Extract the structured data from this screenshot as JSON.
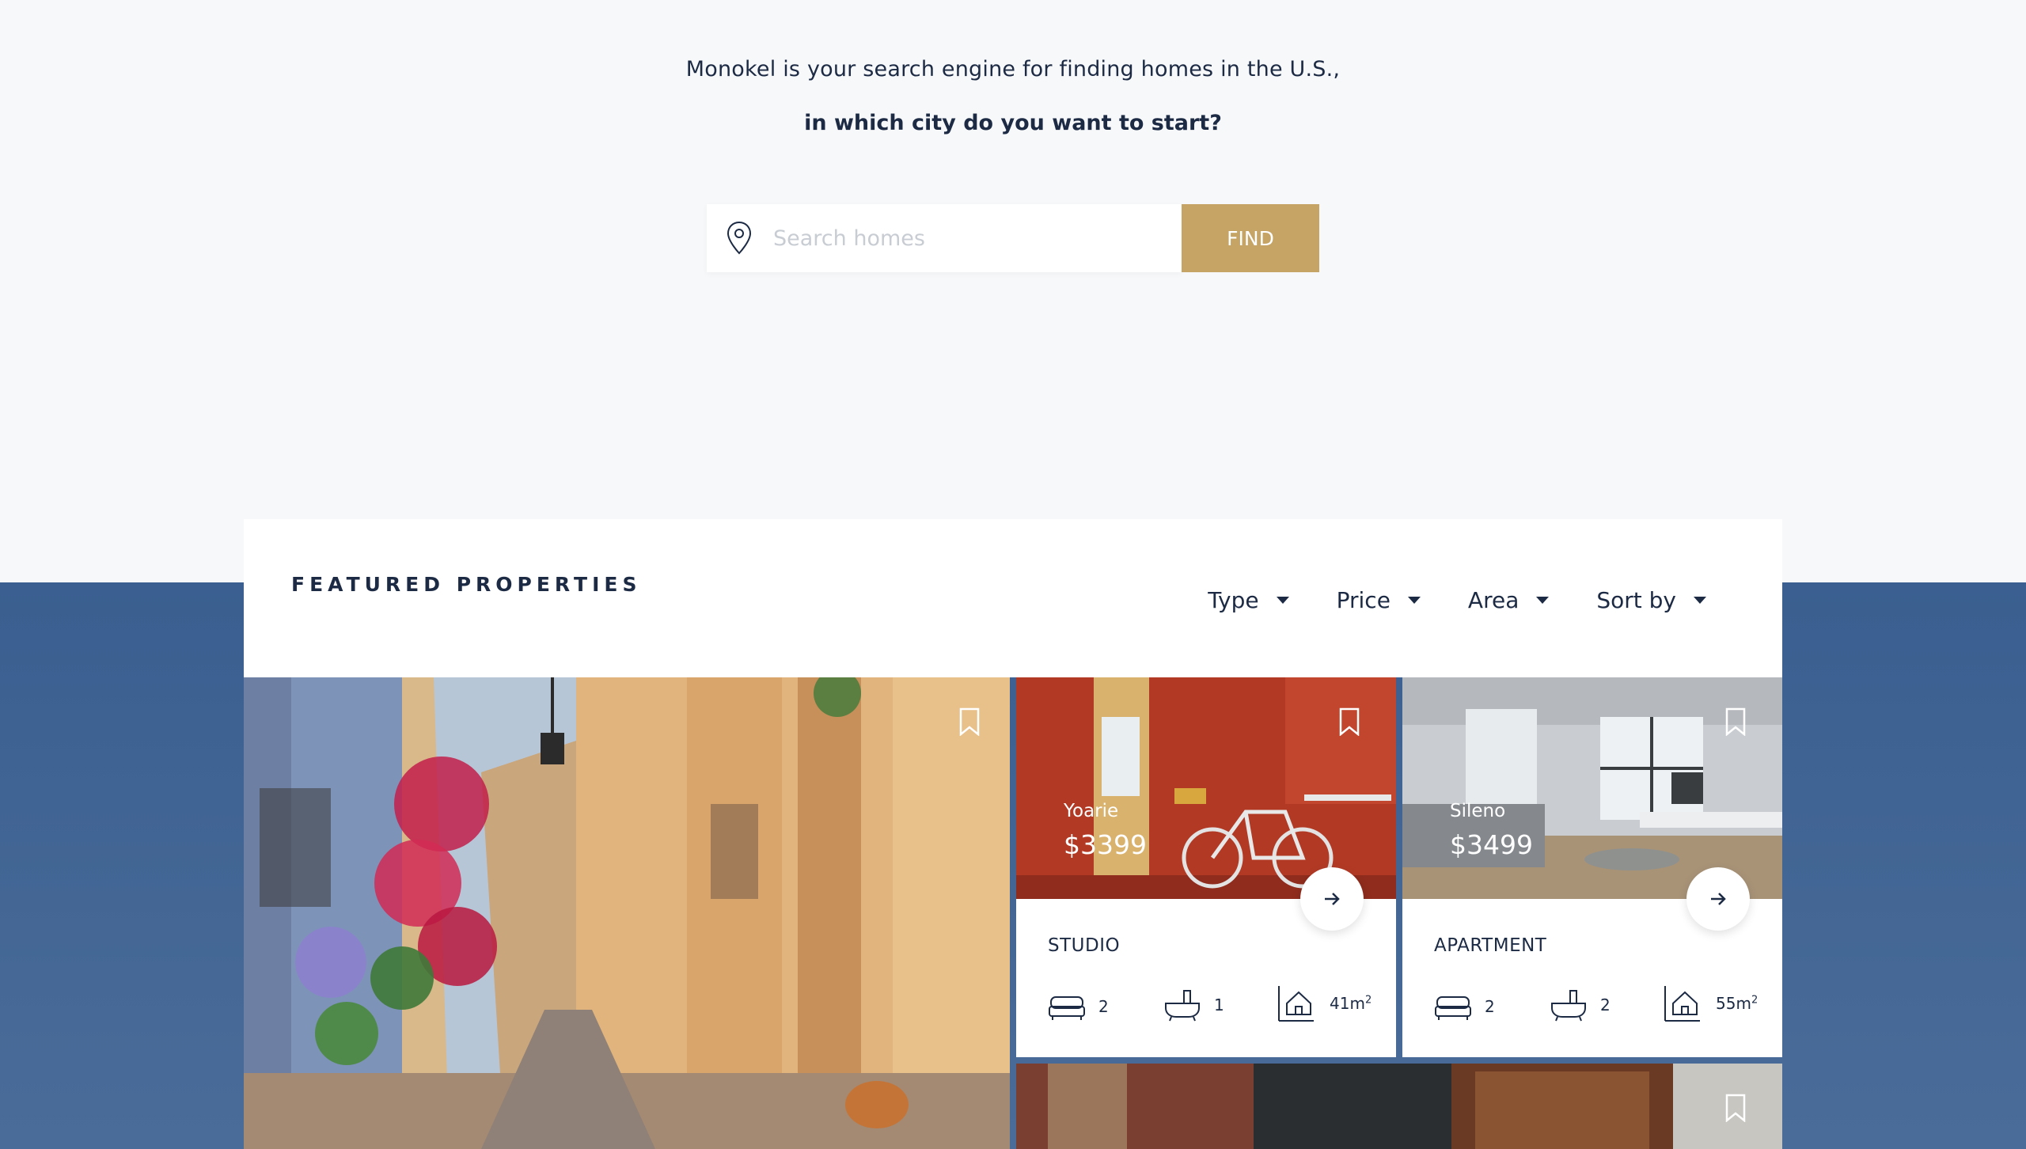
{
  "hero": {
    "tagline": "Monokel is your search engine for finding homes in the U.S.,",
    "question": "in which city do you want to start?",
    "search_placeholder": "Search homes",
    "find_label": "FIND"
  },
  "featured": {
    "title": "FEATURED PROPERTIES",
    "filters": [
      "Type",
      "Price",
      "Area",
      "Sort by"
    ]
  },
  "cards": [
    {
      "name": "Yoarie",
      "price": "$3399",
      "type": "STUDIO",
      "beds": "2",
      "baths": "1",
      "area": "41m",
      "area_unit_sup": "2"
    },
    {
      "name": "Sileno",
      "price": "$3499",
      "type": "APARTMENT",
      "beds": "2",
      "baths": "2",
      "area": "55m",
      "area_unit_sup": "2"
    }
  ],
  "colors": {
    "accent": "#c5a466",
    "navy": "#1c2a44",
    "band": "#3a5f90",
    "background": "#f7f8fa"
  },
  "icons": [
    "map-pin-icon",
    "bookmark-icon",
    "arrow-right-icon",
    "bed-icon",
    "bathtub-icon",
    "house-area-icon",
    "caret-down-icon"
  ]
}
